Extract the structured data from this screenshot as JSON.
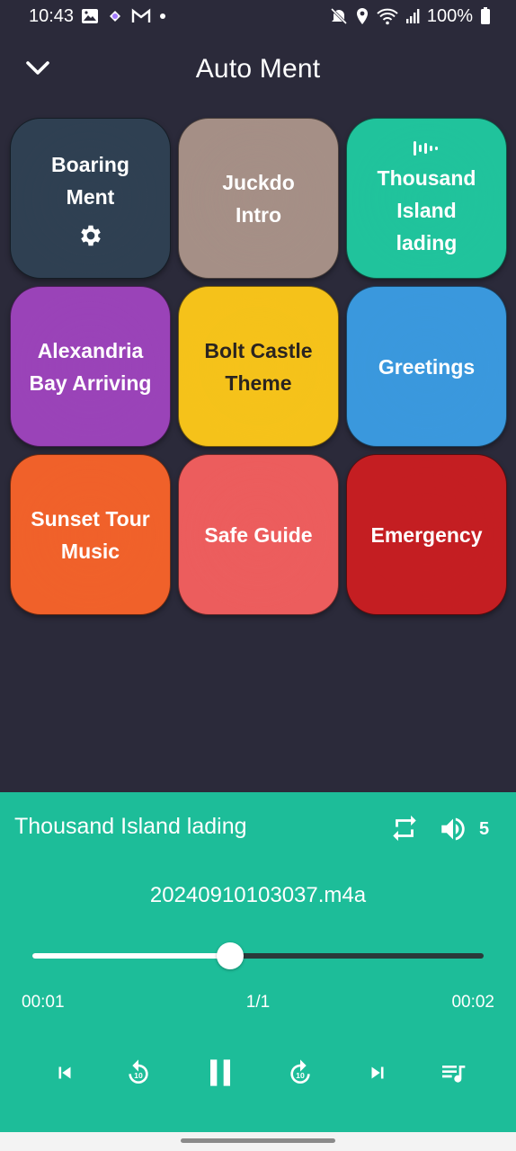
{
  "status_bar": {
    "time": "10:43",
    "battery": "100%",
    "left_icons": [
      "gallery-icon",
      "app-icon",
      "gmail-icon",
      "dot-icon"
    ],
    "right_icons": [
      "mute-icon",
      "location-icon",
      "wifi-icon",
      "signal-icon",
      "battery-icon"
    ]
  },
  "app_bar": {
    "title": "Auto Ment",
    "back_icon": "chevron-down-icon"
  },
  "tiles": [
    {
      "label": "Boaring\nMent",
      "color": "#2f4052",
      "icon_below": "gear-icon"
    },
    {
      "label": "Juckdo\nIntro",
      "color": "#a58f86"
    },
    {
      "label": "Thousand\nIsland\nlading",
      "color": "#20c39c",
      "icon_above": "equalizer-icon"
    },
    {
      "label": "Alexandria\nBay Arriving",
      "color": "#9a43b8"
    },
    {
      "label": "Bolt Castle\nTheme",
      "color": "#f5c21a",
      "text_color": "#2a2420"
    },
    {
      "label": "Greetings",
      "color": "#3a98dd"
    },
    {
      "label": "Sunset Tour\nMusic",
      "color": "#f0612a"
    },
    {
      "label": "Safe Guide",
      "color": "#ec5d5d"
    },
    {
      "label": "Emergency",
      "color": "#c41e22"
    }
  ],
  "player": {
    "now_playing": "Thousand Island lading",
    "volume": "5",
    "file_name": "20240910103037.m4a",
    "progress": 0.438,
    "elapsed": "00:01",
    "track_index": "1/1",
    "duration": "00:02",
    "bg_color": "#1dbd99",
    "controls": [
      "skip-previous-icon",
      "replay-10-icon",
      "pause-icon",
      "forward-10-icon",
      "skip-next-icon",
      "playlist-icon"
    ]
  }
}
